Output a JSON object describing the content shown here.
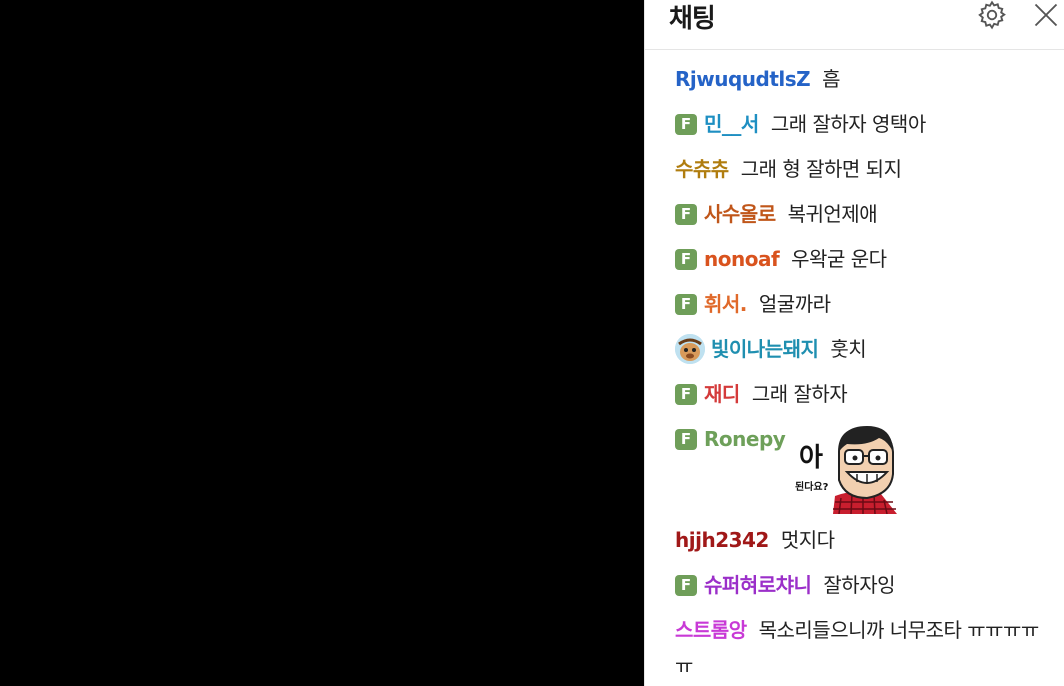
{
  "chat": {
    "title": "채팅",
    "fan_badge_label": "F",
    "messages": [
      {
        "nick": "RjwuqudtlsZ",
        "text": "흠",
        "badge": "none",
        "color": "#2563c7"
      },
      {
        "nick": "민__서",
        "text": "그래 잘하자 영택아",
        "badge": "fan",
        "color": "#1e8fc2"
      },
      {
        "nick": "수츄츄",
        "text": "그래 형 잘하면 되지",
        "badge": "none",
        "color": "#b07d0f"
      },
      {
        "nick": "사수올로",
        "text": "복귀언제애",
        "badge": "fan",
        "color": "#c0561a"
      },
      {
        "nick": "nonoaf",
        "text": "우왁굳 운다",
        "badge": "fan",
        "color": "#d9531e"
      },
      {
        "nick": "휘서.",
        "text": "얼굴까라",
        "badge": "fan",
        "color": "#e0692a"
      },
      {
        "nick": "빛이나는돼지",
        "text": "훗치",
        "badge": "avatar",
        "color": "#1f8fb0"
      },
      {
        "nick": "재디",
        "text": "그래 잘하자",
        "badge": "fan",
        "color": "#d43a3a"
      },
      {
        "nick": "Ronepy",
        "text": "",
        "badge": "fan",
        "color": "#6ea05a"
      },
      {
        "nick": "hjjh2342",
        "text": "멋지다",
        "badge": "none",
        "color": "#a01818"
      },
      {
        "nick": "슈퍼혀로챠니",
        "text": "잘하자잉",
        "badge": "fan",
        "color": "#9b2fc9"
      },
      {
        "nick": "스트롬앙",
        "text": "목소리들으니까 너무조타 ㅠㅠㅠㅠ",
        "text_wrap": "ㅠ",
        "badge": "none",
        "color": "#c83ad6"
      }
    ],
    "sticker": {
      "big_text": "아",
      "small_text": "된다요?"
    }
  }
}
